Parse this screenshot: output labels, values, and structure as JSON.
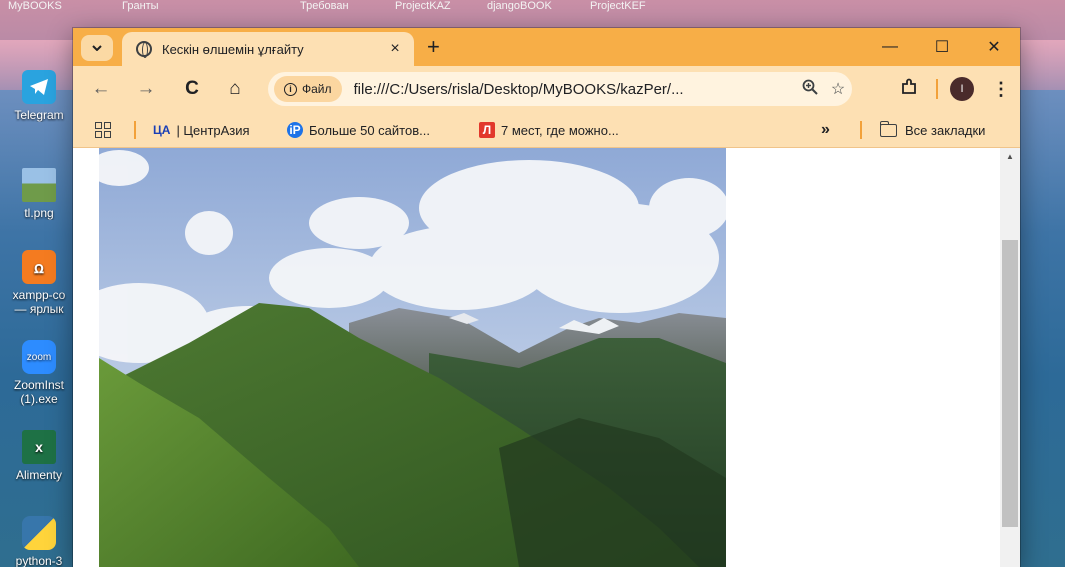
{
  "desktop": {
    "top_labels": [
      "MyBOOKS",
      "Гранты",
      "Требован",
      "ProjectKAZ",
      "djangoBOOK",
      "ProjectKEF"
    ],
    "icons": [
      {
        "label": "Telegram",
        "icon": "telegram-icon",
        "color": "#2aa3df"
      },
      {
        "label": "tl.png",
        "icon": "image-file-icon",
        "color": "#7aa35a"
      },
      {
        "label": "xampp-co",
        "label2": "— ярлык",
        "icon": "xampp-icon",
        "color": "#f47b20"
      },
      {
        "label": "ZoomInst",
        "label2": "(1).exe",
        "icon": "zoom-icon",
        "color": "#2d8cff",
        "text": "zoom"
      },
      {
        "label": "Alimenty",
        "icon": "excel-icon",
        "color": "#1e7145"
      },
      {
        "label": "python-3",
        "icon": "python-icon",
        "color": "#3776ab"
      }
    ]
  },
  "browser": {
    "tab_title": "Кескін өлшемін ұлғайту",
    "tab_close": "×",
    "new_tab": "+",
    "window_controls": {
      "minimize": "—",
      "maximize": "☐",
      "close": "✕"
    },
    "nav": {
      "back": "←",
      "forward": "→",
      "reload": "C",
      "home": "⌂"
    },
    "site_chip": "Файл",
    "url": "file:///C:/Users/risla/Desktop/MyBOOKS/kazPer/...",
    "avatar_letter": "I",
    "bookmarks": [
      {
        "favicon": "ЦА",
        "label": "| ЦентрАзия"
      },
      {
        "favicon": "iP",
        "label": "Больше 50 сайтов..."
      },
      {
        "favicon": "Л",
        "label": "7 мест, где можно..."
      }
    ],
    "more_bookmarks": "»",
    "all_bookmarks": "Все закладки"
  },
  "colors": {
    "chrome_frame": "#f7ae47",
    "chrome_toolbar": "#fde0b3",
    "scrollbar_thumb": "#c1c1c1"
  }
}
